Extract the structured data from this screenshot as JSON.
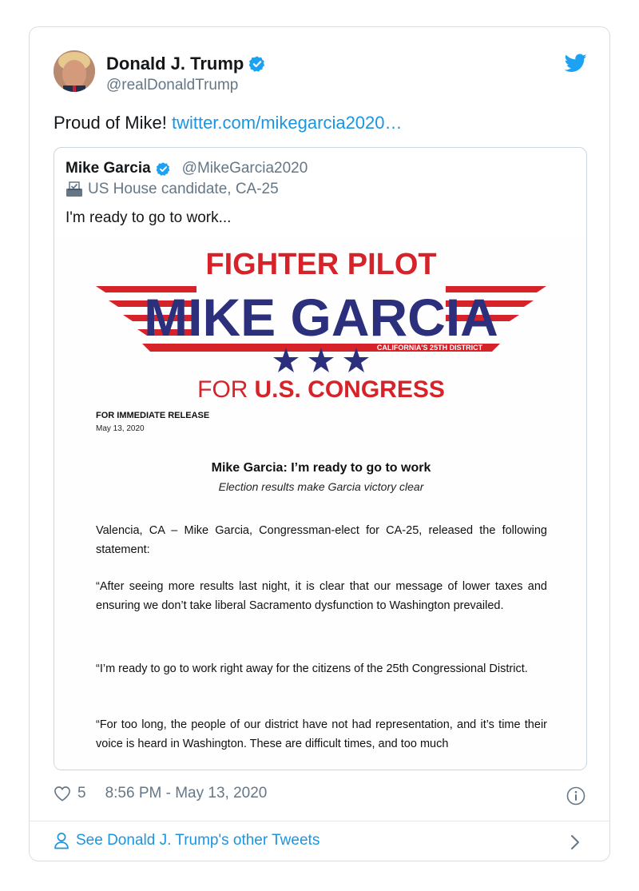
{
  "tweet": {
    "author_name": "Donald J. Trump",
    "author_handle": "@realDonaldTrump",
    "text": "Proud of Mike! ",
    "link_text": "twitter.com/mikegarcia2020…",
    "likes": "5",
    "timestamp": "8:56 PM - May 13, 2020",
    "footer_link": "See Donald J. Trump's other Tweets"
  },
  "quoted": {
    "name": "Mike Garcia",
    "handle": "@MikeGarcia2020",
    "description": "US House candidate, CA-25",
    "text": "I'm ready to go to work..."
  },
  "press": {
    "logo_top": "FIGHTER PILOT",
    "logo_name": "MIKE GARCIA",
    "logo_district": "CALIFORNIA'S 25TH DISTRICT",
    "logo_for": "FOR",
    "logo_congress": "U.S. CONGRESS",
    "release": "FOR IMMEDIATE RELEASE",
    "date": "May 13, 2020",
    "headline": "Mike Garcia: I’m ready to go to work",
    "subheadline": "Election results make Garcia victory clear",
    "para1": "Valencia, CA – Mike Garcia, Congressman-elect for CA-25, released the following statement:",
    "para2": "“After seeing more results last night, it is clear that our message of lower taxes and ensuring we don’t take liberal Sacramento dysfunction to Washington prevailed.",
    "para3": "“I’m ready to go to work right away for the citizens of the 25th Congressional District.",
    "para4": "“For too long, the people of our district have not had representation, and it’s time their voice is heard in Washington. These are difficult times, and too much"
  },
  "colors": {
    "logo_red": "#d6232a",
    "logo_blue": "#2b2f7c",
    "link_blue": "#1b95e0",
    "secondary_text": "#657786"
  },
  "icons": [
    "verified-badge-icon",
    "twitter-bird-icon",
    "ballot-box-icon",
    "heart-icon",
    "info-icon",
    "person-icon",
    "chevron-right-icon"
  ]
}
